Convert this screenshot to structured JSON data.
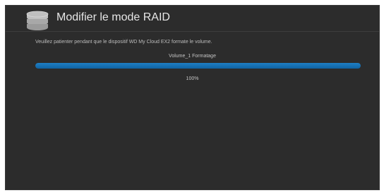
{
  "dialog": {
    "icon": "database-icon",
    "title": "Modifier le mode RAID",
    "message": "Veuillez patienter pendant que le dispositif WD My Cloud EX2 formate le volume."
  },
  "progress": {
    "label": "Volume_1 Formatage",
    "value_percent": 100,
    "percent_text": "100%",
    "bar_color": "#1474b8"
  },
  "colors": {
    "background": "#2c2c2c",
    "text": "#e6e6e6",
    "accent": "#1474b8"
  }
}
